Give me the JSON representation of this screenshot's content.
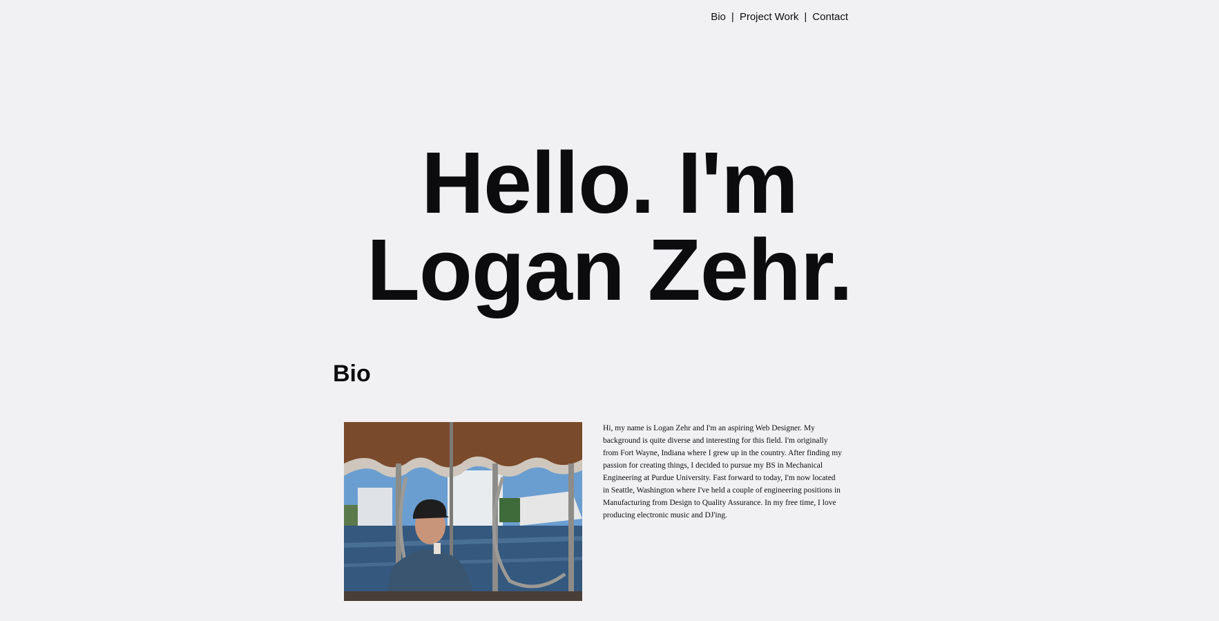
{
  "nav": {
    "items": [
      {
        "label": "Bio"
      },
      {
        "label": "Project Work"
      },
      {
        "label": "Contact"
      }
    ],
    "separator": "|"
  },
  "hero": {
    "line1": "Hello. I'm",
    "line2": "Logan Zehr."
  },
  "bio": {
    "heading": "Bio",
    "photo_icon": "portrait-photo",
    "text": "Hi, my name is Logan Zehr and I'm an aspiring Web Designer. My background is quite diverse and interesting for this field. I'm originally from Fort Wayne, Indiana where I grew up in the country. After finding my passion for creating things, I decided to pursue my BS in Mechanical Engineering at Purdue University. Fast forward to today, I'm now located in Seattle, Washington where I've held a couple of engineering positions in Manufacturing from Design to Quality Assurance. In my free time, I love producing electronic music and DJ'ing."
  },
  "colors": {
    "background": "#f1f1f3",
    "text": "#0c0b0e"
  }
}
